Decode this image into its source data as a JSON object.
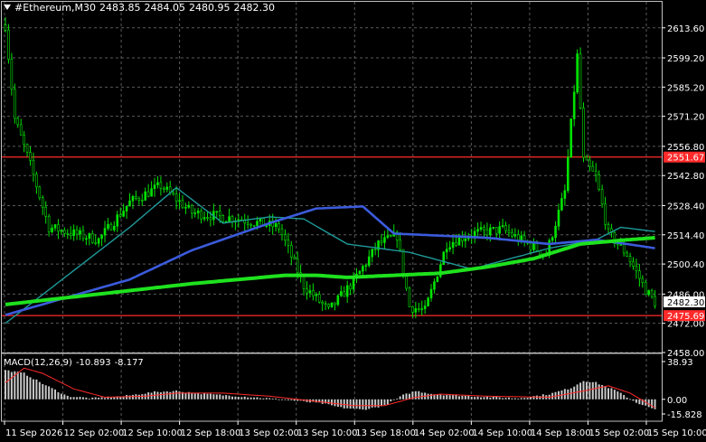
{
  "header": {
    "symbol": "#Ethereum,M30",
    "open": "2483.85",
    "high": "2484.05",
    "low": "2480.95",
    "close": "2482.30"
  },
  "indicator": {
    "name": "MACD(12,26,9)",
    "value_main": "-10.893",
    "value_signal": "-8.177"
  },
  "colors": {
    "background": "#000000",
    "candle": "#00e400",
    "grid": "#5a5a5a",
    "axis_text": "#ffffff",
    "hline": "#ff2a2a",
    "ma_fast": "#1f9a9a",
    "ma_mid": "#3b5bdc",
    "ma_slow": "#1ee21e",
    "histogram": "#c8c8c8",
    "signal": "#ff2a2a",
    "price_box_bg": "#ffffff",
    "price_box_text": "#000000"
  },
  "price_axis": {
    "labels": [
      "2613.60",
      "2599.20",
      "2585.20",
      "2571.20",
      "2556.80",
      "2542.80",
      "2528.40",
      "2514.40",
      "2500.40",
      "2486.00",
      "2472.00",
      "2458.00"
    ]
  },
  "price_markers": [
    {
      "value": "2551.67",
      "kind": "level"
    },
    {
      "value": "2482.30",
      "kind": "current"
    },
    {
      "value": "2475.69",
      "kind": "level"
    }
  ],
  "macd_axis": {
    "labels": [
      "38.93",
      "0.00",
      "-15.828"
    ]
  },
  "time_axis": {
    "labels": [
      "11 Sep 2026",
      "12 Sep 02:00",
      "12 Sep 10:00",
      "12 Sep 18:00",
      "13 Sep 02:00",
      "13 Sep 10:00",
      "13 Sep 18:00",
      "14 Sep 02:00",
      "14 Sep 10:00",
      "14 Sep 18:00",
      "15 Sep 02:00",
      "15 Sep 10:00"
    ]
  },
  "chart_data": {
    "type": "candlestick",
    "ylim": [
      2458,
      2620
    ],
    "close_anchors": [
      [
        0,
        2615
      ],
      [
        3,
        2570
      ],
      [
        8,
        2548
      ],
      [
        14,
        2518
      ],
      [
        30,
        2512
      ],
      [
        40,
        2530
      ],
      [
        50,
        2538
      ],
      [
        60,
        2525
      ],
      [
        75,
        2522
      ],
      [
        88,
        2518
      ],
      [
        96,
        2490
      ],
      [
        104,
        2478
      ],
      [
        112,
        2492
      ],
      [
        120,
        2510
      ],
      [
        126,
        2514
      ],
      [
        130,
        2480
      ],
      [
        135,
        2478
      ],
      [
        142,
        2510
      ],
      [
        150,
        2515
      ],
      [
        160,
        2517
      ],
      [
        168,
        2510
      ],
      [
        174,
        2505
      ],
      [
        180,
        2535
      ],
      [
        184,
        2600
      ],
      [
        186,
        2550
      ],
      [
        190,
        2542
      ],
      [
        194,
        2515
      ],
      [
        200,
        2505
      ],
      [
        206,
        2488
      ],
      [
        209,
        2482
      ]
    ],
    "ma_fast": [
      [
        0,
        2472
      ],
      [
        40,
        2518
      ],
      [
        55,
        2537
      ],
      [
        70,
        2520
      ],
      [
        85,
        2523
      ],
      [
        96,
        2522
      ],
      [
        110,
        2510
      ],
      [
        130,
        2506
      ],
      [
        150,
        2498
      ],
      [
        175,
        2508
      ],
      [
        190,
        2512
      ],
      [
        198,
        2518
      ],
      [
        209,
        2516
      ]
    ],
    "ma_mid": [
      [
        0,
        2476
      ],
      [
        40,
        2493
      ],
      [
        60,
        2507
      ],
      [
        85,
        2520
      ],
      [
        100,
        2527
      ],
      [
        115,
        2528
      ],
      [
        125,
        2515
      ],
      [
        140,
        2514
      ],
      [
        155,
        2513
      ],
      [
        175,
        2510
      ],
      [
        190,
        2512
      ],
      [
        200,
        2510
      ],
      [
        209,
        2508
      ]
    ],
    "ma_slow": [
      [
        0,
        2481
      ],
      [
        30,
        2486
      ],
      [
        60,
        2491
      ],
      [
        90,
        2495
      ],
      [
        100,
        2495
      ],
      [
        110,
        2494
      ],
      [
        125,
        2495
      ],
      [
        140,
        2496
      ],
      [
        155,
        2499
      ],
      [
        170,
        2503
      ],
      [
        185,
        2510
      ],
      [
        200,
        2512
      ],
      [
        209,
        2513
      ]
    ],
    "hlines": [
      2551.67,
      2475.69
    ],
    "macd": {
      "ylim": [
        -15.828,
        38.93
      ],
      "histogram_anchors": [
        [
          0,
          28
        ],
        [
          6,
          25
        ],
        [
          12,
          15
        ],
        [
          20,
          3
        ],
        [
          28,
          1
        ],
        [
          38,
          3
        ],
        [
          48,
          7
        ],
        [
          55,
          8
        ],
        [
          65,
          5
        ],
        [
          80,
          2
        ],
        [
          92,
          -1
        ],
        [
          102,
          -4
        ],
        [
          108,
          -8
        ],
        [
          115,
          -10
        ],
        [
          122,
          -6
        ],
        [
          128,
          4
        ],
        [
          132,
          8
        ],
        [
          138,
          5
        ],
        [
          150,
          3
        ],
        [
          165,
          1
        ],
        [
          175,
          5
        ],
        [
          182,
          11
        ],
        [
          186,
          18
        ],
        [
          190,
          16
        ],
        [
          196,
          9
        ],
        [
          203,
          -3
        ],
        [
          209,
          -10
        ]
      ],
      "signal_anchors": [
        [
          0,
          16
        ],
        [
          6,
          30
        ],
        [
          12,
          25
        ],
        [
          22,
          10
        ],
        [
          32,
          2
        ],
        [
          45,
          3
        ],
        [
          55,
          6
        ],
        [
          70,
          6
        ],
        [
          85,
          3
        ],
        [
          100,
          -2
        ],
        [
          112,
          -6
        ],
        [
          122,
          -6
        ],
        [
          132,
          2
        ],
        [
          140,
          5
        ],
        [
          155,
          3
        ],
        [
          175,
          2
        ],
        [
          186,
          8
        ],
        [
          194,
          13
        ],
        [
          201,
          6
        ],
        [
          209,
          -8
        ]
      ]
    }
  }
}
